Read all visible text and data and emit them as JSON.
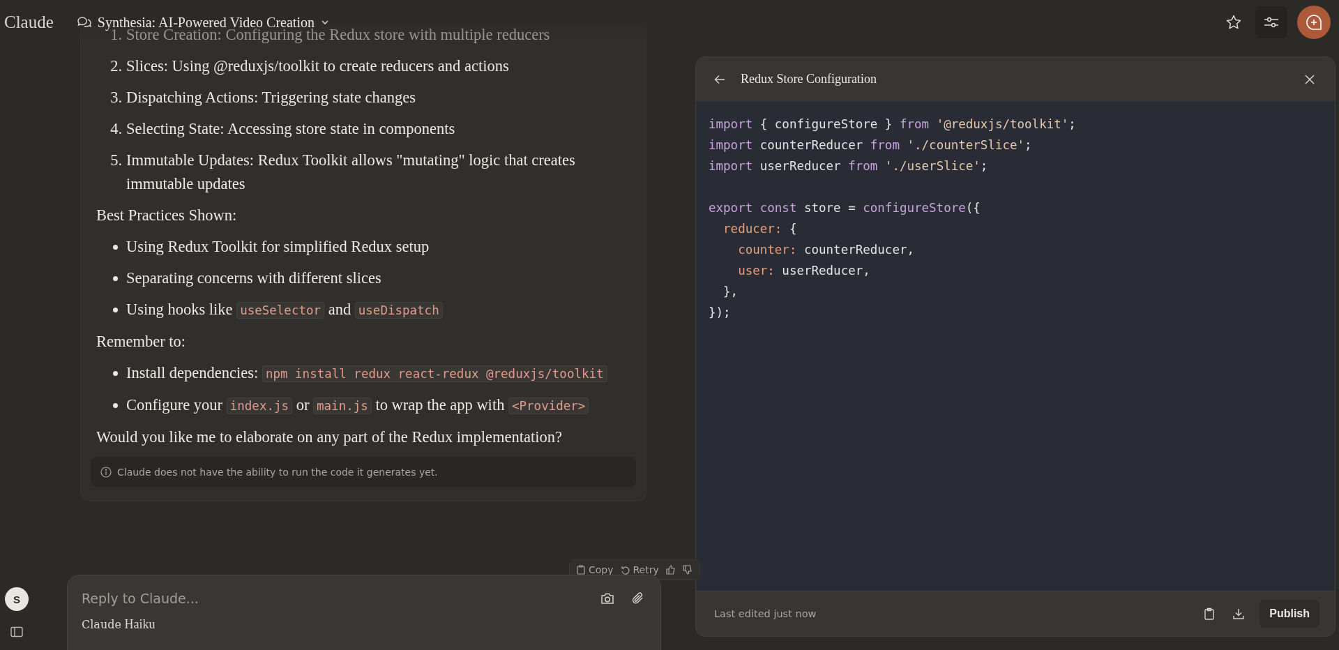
{
  "app": {
    "logo": "Claude"
  },
  "conversation": {
    "title": "Synthesia: AI-Powered Video Creation"
  },
  "user": {
    "initial": "S"
  },
  "message": {
    "blocks": [
      {
        "kind": "numbered",
        "faded": true,
        "number": "1.",
        "parts": [
          {
            "kind": "text",
            "text": "Store Creation: Configuring the Redux store with multiple reducers"
          }
        ]
      },
      {
        "kind": "numbered",
        "faded": false,
        "number": "2.",
        "parts": [
          {
            "kind": "text",
            "text": "Slices: Using @reduxjs/toolkit to create reducers and actions"
          }
        ]
      },
      {
        "kind": "numbered",
        "faded": false,
        "number": "3.",
        "parts": [
          {
            "kind": "text",
            "text": "Dispatching Actions: Triggering state changes"
          }
        ]
      },
      {
        "kind": "numbered",
        "faded": false,
        "number": "4.",
        "parts": [
          {
            "kind": "text",
            "text": "Selecting State: Accessing store state in components"
          }
        ]
      },
      {
        "kind": "numbered",
        "faded": false,
        "number": "5.",
        "parts": [
          {
            "kind": "text",
            "text": "Immutable Updates: Redux Toolkit allows \"mutating\" logic that creates immutable updates"
          }
        ]
      },
      {
        "kind": "paragraph",
        "faded": false,
        "parts": [
          {
            "kind": "text",
            "text": "Best Practices Shown:"
          }
        ]
      },
      {
        "kind": "bullet",
        "faded": false,
        "parts": [
          {
            "kind": "text",
            "text": "Using Redux Toolkit for simplified Redux setup"
          }
        ]
      },
      {
        "kind": "bullet",
        "faded": false,
        "parts": [
          {
            "kind": "text",
            "text": "Separating concerns with different slices"
          }
        ]
      },
      {
        "kind": "bullet",
        "faded": false,
        "parts": [
          {
            "kind": "text",
            "text": "Using hooks like "
          },
          {
            "kind": "code",
            "text": "useSelector"
          },
          {
            "kind": "text",
            "text": " and "
          },
          {
            "kind": "code",
            "text": "useDispatch"
          }
        ]
      },
      {
        "kind": "paragraph",
        "faded": false,
        "parts": [
          {
            "kind": "text",
            "text": "Remember to:"
          }
        ]
      },
      {
        "kind": "bullet",
        "faded": false,
        "parts": [
          {
            "kind": "text",
            "text": "Install dependencies: "
          },
          {
            "kind": "code",
            "text": "npm install redux react-redux @reduxjs/toolkit"
          }
        ]
      },
      {
        "kind": "bullet",
        "faded": false,
        "parts": [
          {
            "kind": "text",
            "text": "Configure your "
          },
          {
            "kind": "code",
            "text": "index.js"
          },
          {
            "kind": "text",
            "text": " or "
          },
          {
            "kind": "code",
            "text": "main.js"
          },
          {
            "kind": "text",
            "text": " to wrap the app with "
          },
          {
            "kind": "code",
            "text": "<Provider>"
          }
        ]
      },
      {
        "kind": "paragraph",
        "faded": false,
        "parts": [
          {
            "kind": "text",
            "text": "Would you like me to elaborate on any part of the Redux implementation?"
          }
        ]
      }
    ],
    "notice": "Claude does not have the ability to run the code it generates yet.",
    "actions": [
      {
        "kind": "copy",
        "label": "Copy"
      },
      {
        "kind": "retry",
        "label": "Retry"
      },
      {
        "kind": "thumbs-up"
      },
      {
        "kind": "thumbs-down"
      }
    ]
  },
  "composer": {
    "placeholder": "Reply to Claude...",
    "model": {
      "brand": "Claude",
      "name": "Haiku"
    }
  },
  "artifact": {
    "title": "Redux Store Configuration",
    "code": [
      {
        "kind": "code",
        "tokens": [
          {
            "kind": "keyword",
            "text": "import"
          },
          {
            "kind": "plain",
            "text": " { configureStore } "
          },
          {
            "kind": "keyword",
            "text": "from "
          },
          {
            "kind": "string",
            "text": "'@reduxjs/toolkit'"
          },
          {
            "kind": "plain",
            "text": ";"
          }
        ]
      },
      {
        "kind": "code",
        "tokens": [
          {
            "kind": "keyword",
            "text": "import"
          },
          {
            "kind": "plain",
            "text": " counterReducer "
          },
          {
            "kind": "keyword",
            "text": "from "
          },
          {
            "kind": "string",
            "text": "'./counterSlice'"
          },
          {
            "kind": "plain",
            "text": ";"
          }
        ]
      },
      {
        "kind": "code",
        "tokens": [
          {
            "kind": "keyword",
            "text": "import"
          },
          {
            "kind": "plain",
            "text": " userReducer "
          },
          {
            "kind": "keyword",
            "text": "from "
          },
          {
            "kind": "string",
            "text": "'./userSlice'"
          },
          {
            "kind": "plain",
            "text": ";"
          }
        ]
      },
      {
        "kind": "blank"
      },
      {
        "kind": "code",
        "tokens": [
          {
            "kind": "keyword",
            "text": "export const"
          },
          {
            "kind": "plain",
            "text": " store = "
          },
          {
            "kind": "function",
            "text": "configureStore"
          },
          {
            "kind": "plain",
            "text": "({"
          }
        ]
      },
      {
        "kind": "code",
        "tokens": [
          {
            "kind": "property",
            "text": "  reducer:"
          },
          {
            "kind": "plain",
            "text": " {"
          }
        ]
      },
      {
        "kind": "code",
        "tokens": [
          {
            "kind": "property",
            "text": "    counter:"
          },
          {
            "kind": "plain",
            "text": " counterReducer,"
          }
        ]
      },
      {
        "kind": "code",
        "tokens": [
          {
            "kind": "property",
            "text": "    user:"
          },
          {
            "kind": "plain",
            "text": " userReducer,"
          }
        ]
      },
      {
        "kind": "code",
        "tokens": [
          {
            "kind": "plain",
            "text": "  },"
          }
        ]
      },
      {
        "kind": "code",
        "tokens": [
          {
            "kind": "plain",
            "text": "});"
          }
        ]
      }
    ],
    "status": "Last edited just now",
    "publish": "Publish"
  }
}
